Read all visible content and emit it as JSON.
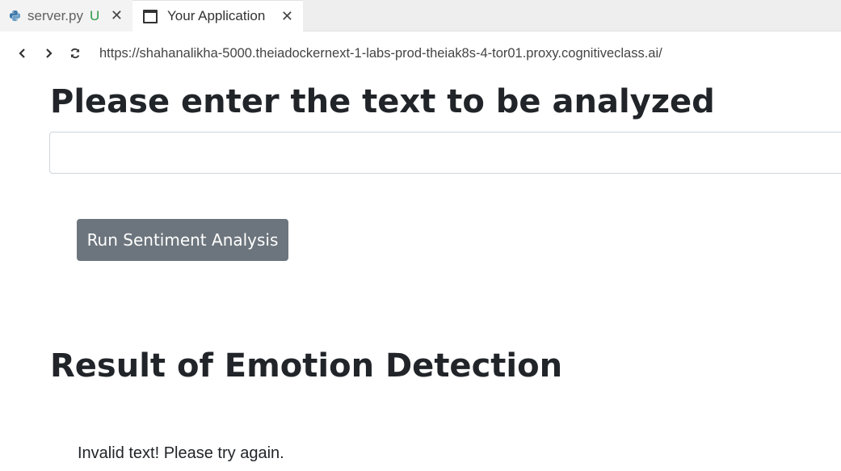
{
  "tabs": [
    {
      "label": "server.py",
      "status": "U",
      "icon": "python-file-icon",
      "active": false
    },
    {
      "label": "Your Application",
      "icon": "preview-window-icon",
      "active": true
    }
  ],
  "navbar": {
    "url": "https://shahanalikha-5000.theiadockernext-1-labs-prod-theiak8s-4-tor01.proxy.cognitiveclass.ai/"
  },
  "page": {
    "input_heading": "Please enter the text to be analyzed",
    "text_input_value": "",
    "run_button_label": "Run Sentiment Analysis",
    "result_heading": "Result of Emotion Detection",
    "result_text": "Invalid text! Please try again."
  },
  "colors": {
    "button_bg": "#6c757d",
    "heading_text": "#212529",
    "tab_status_untracked": "#2e9a44"
  }
}
